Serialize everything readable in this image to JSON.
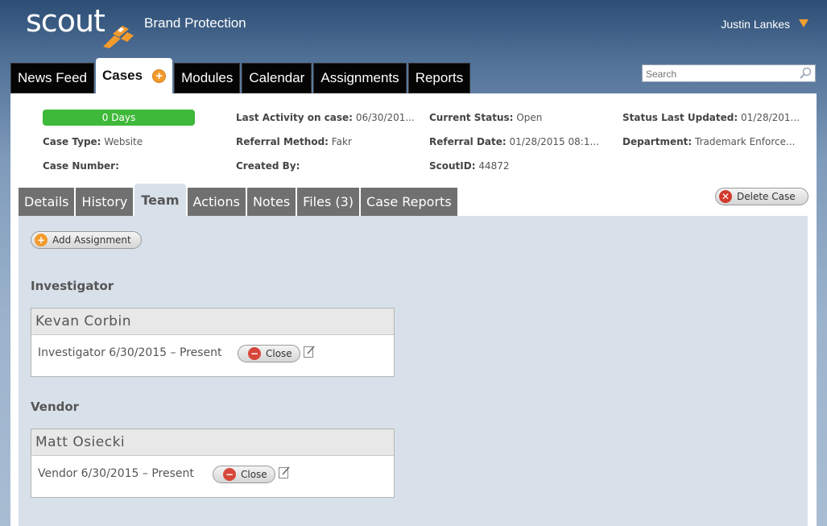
{
  "header": {
    "logo_text": "scout",
    "app_title": "Brand Protection",
    "user_name": "Justin Lankes"
  },
  "nav": {
    "tabs": [
      "News Feed",
      "Cases",
      "Modules",
      "Calendar",
      "Assignments",
      "Reports"
    ],
    "active": "Cases"
  },
  "search": {
    "placeholder": "Search"
  },
  "case_info": {
    "days_label": "0 Days",
    "case_type_label": "Case Type:",
    "case_type_value": "Website",
    "case_number_label": "Case Number:",
    "case_number_value": "",
    "last_activity_label": "Last Activity on case:",
    "last_activity_value": "06/30/201...",
    "referral_method_label": "Referral Method:",
    "referral_method_value": "Fakr",
    "created_by_label": "Created By:",
    "created_by_value": "",
    "current_status_label": "Current Status:",
    "current_status_value": "Open",
    "referral_date_label": "Referral Date:",
    "referral_date_value": "01/28/2015 08:1...",
    "scout_id_label": "ScoutID:",
    "scout_id_value": "44872",
    "status_updated_label": "Status Last Updated:",
    "status_updated_value": "01/28/201...",
    "department_label": "Department:",
    "department_value": "Trademark Enforce..."
  },
  "case_tabs": {
    "details": "Details",
    "history": "History",
    "team": "Team",
    "actions": "Actions",
    "notes": "Notes",
    "files": "Files (3)",
    "case_reports": "Case Reports"
  },
  "buttons": {
    "delete_case": "Delete Case",
    "add_assignment": "Add Assignment",
    "close": "Close"
  },
  "team": {
    "investigator_heading": "Investigator",
    "investigator_name": "Kevan Corbin",
    "investigator_role": "Investigator  6/30/2015 – Present",
    "vendor_heading": "Vendor",
    "vendor_name": "Matt Osiecki",
    "vendor_role": "Vendor  6/30/2015 – Present"
  },
  "colors": {
    "accent_orange": "#f39b2d",
    "days_green": "#3fb93a",
    "delete_red": "#d23a2e"
  }
}
